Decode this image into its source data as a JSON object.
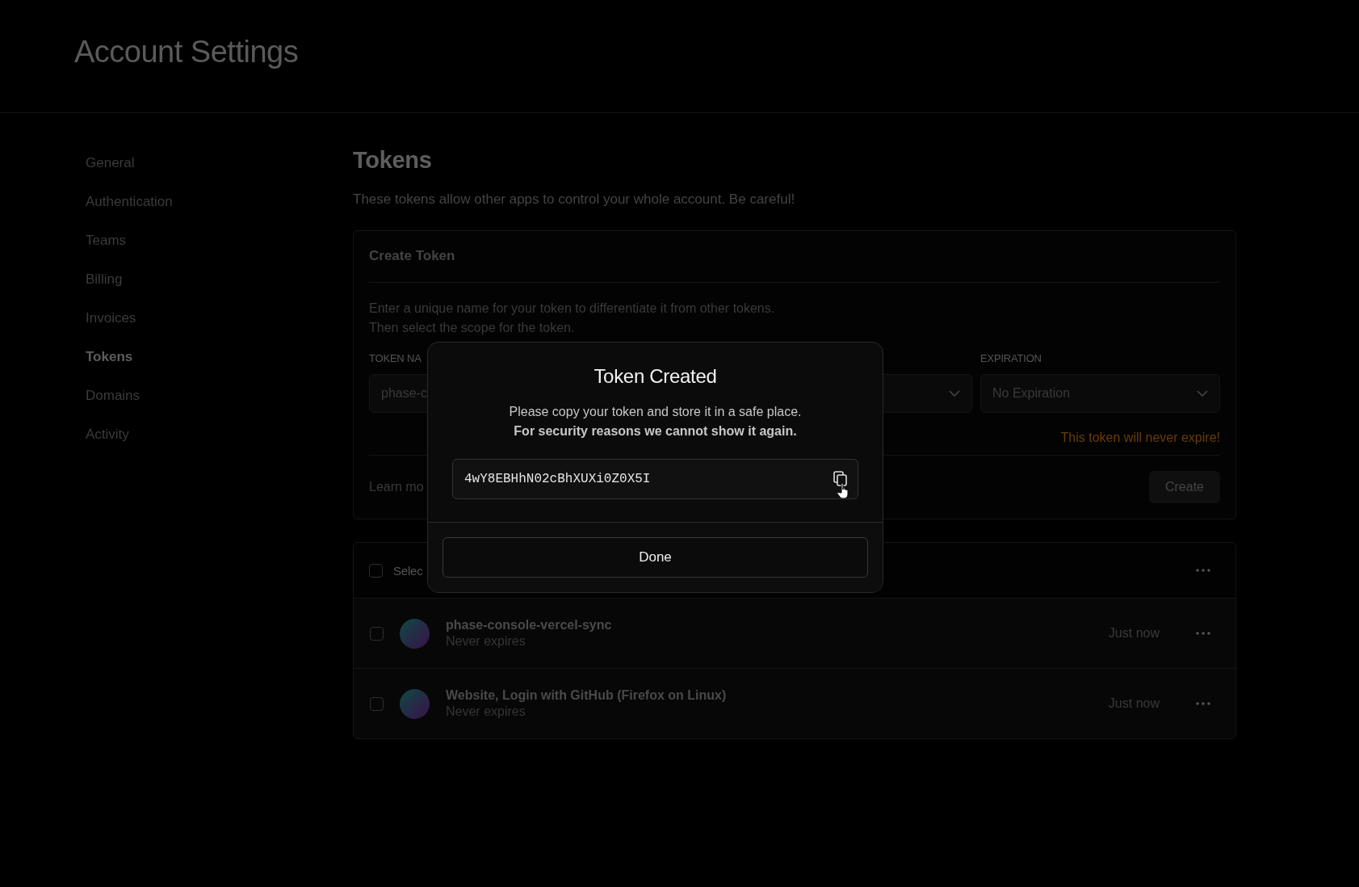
{
  "header": {
    "title": "Account Settings"
  },
  "sidebar": {
    "items": [
      {
        "label": "General",
        "selected": false
      },
      {
        "label": "Authentication",
        "selected": false
      },
      {
        "label": "Teams",
        "selected": false
      },
      {
        "label": "Billing",
        "selected": false
      },
      {
        "label": "Invoices",
        "selected": false
      },
      {
        "label": "Tokens",
        "selected": true
      },
      {
        "label": "Domains",
        "selected": false
      },
      {
        "label": "Activity",
        "selected": false
      }
    ]
  },
  "page": {
    "title": "Tokens",
    "description": "These tokens allow other apps to control your whole account. Be careful!"
  },
  "create_card": {
    "title": "Create Token",
    "description": [
      "Enter a unique name for your token to differentiate it from other tokens.",
      "Then select the scope for the token."
    ],
    "token_name": {
      "label": "TOKEN NA",
      "value": "phase-c"
    },
    "expiration": {
      "label": "EXPIRATION",
      "value": "No Expiration"
    },
    "warning": "This token will never expire!",
    "learn_more": "Learn mo",
    "create_button": "Create"
  },
  "token_list": {
    "select_all": {
      "label": "Selec",
      "checked": false
    },
    "rows": [
      {
        "name": "phase-console-vercel-sync",
        "expiry": "Never expires",
        "time": "Just now",
        "checked": false
      },
      {
        "name": "Website, Login with GitHub (Firefox on Linux)",
        "expiry": "Never expires",
        "time": "Just now",
        "checked": false
      }
    ]
  },
  "modal": {
    "title": "Token Created",
    "message": "Please copy your token and store it in a safe place.",
    "notice": "For security reasons we cannot show it again.",
    "token": "4wY8EBHhN02cBhXUXi0Z0X5I",
    "done_button": "Done"
  }
}
